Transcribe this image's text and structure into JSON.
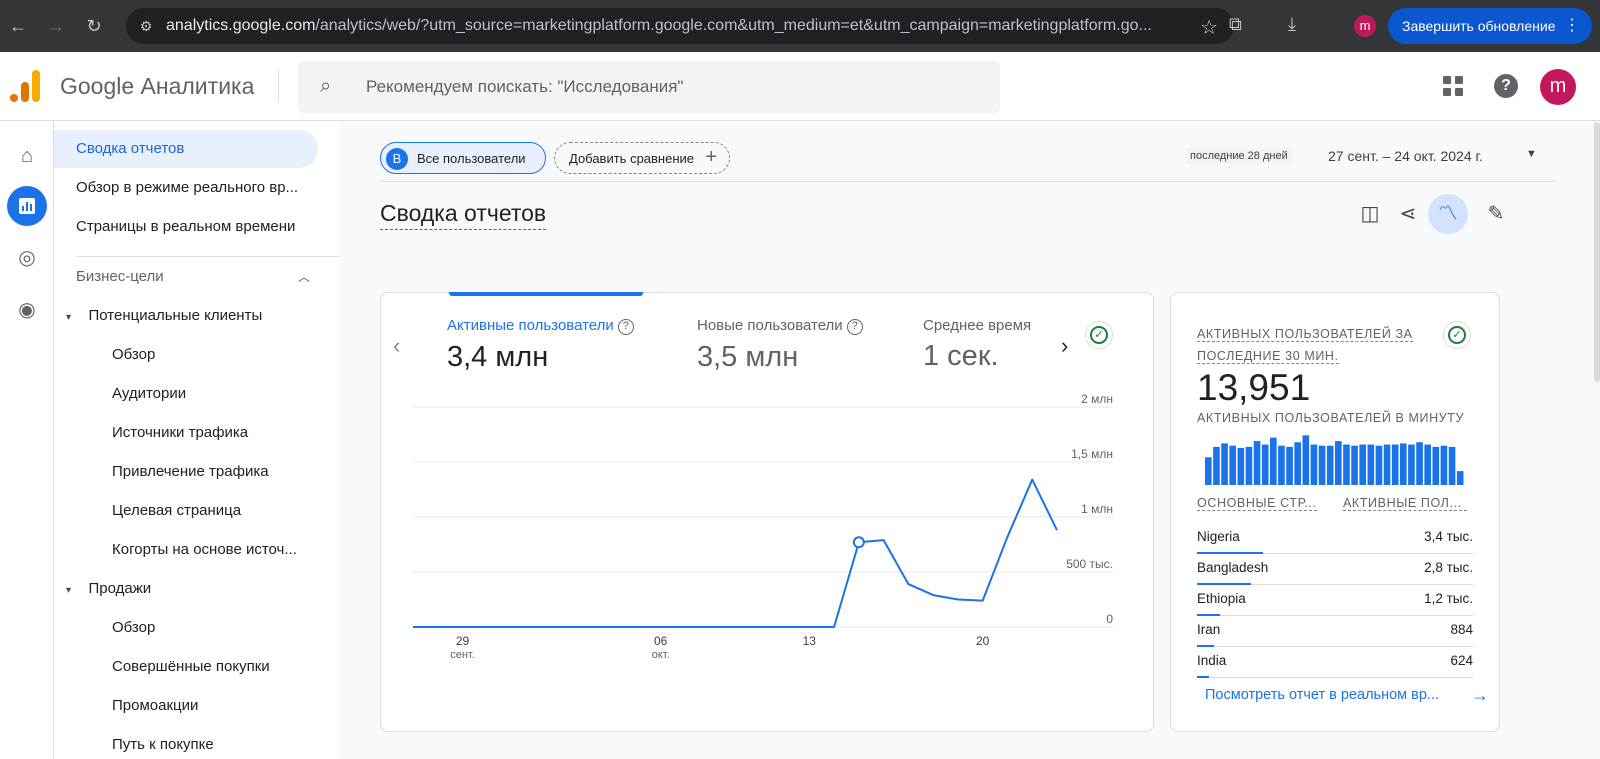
{
  "browser": {
    "url_host": "analytics.google.com",
    "url_path": "/analytics/web/?utm_source=marketingplatform.google.com&utm_medium=et&utm_campaign=marketingplatform.go...",
    "profile_initial": "m",
    "update_label": "Завершить обновление"
  },
  "header": {
    "brand": "Google Аналитика",
    "search_placeholder": "Рекомендуем поискать: \"Исследования\"",
    "avatar_initial": "m"
  },
  "sidebar": {
    "items": [
      {
        "label": "Сводка отчетов"
      },
      {
        "label": "Обзор в режиме реального вр..."
      },
      {
        "label": "Страницы в реальном времени"
      }
    ],
    "section": "Бизнес-цели",
    "groups": [
      {
        "label": "Потенциальные клиенты",
        "items": [
          "Обзор",
          "Аудитории",
          "Источники трафика",
          "Привлечение трафика",
          "Целевая страница",
          "Когорты на основе источ..."
        ]
      },
      {
        "label": "Продажи",
        "items": [
          "Обзор",
          "Совершённые покупки",
          "Промоакции",
          "Путь к покупке"
        ]
      }
    ]
  },
  "main": {
    "chip_all_badge": "В",
    "chip_all": "Все пользователи",
    "chip_add": "Добавить сравнение",
    "date_tag": "последние 28 дней",
    "date_range": "27 сент. – 24 окт. 2024 г.",
    "title": "Сводка отчетов",
    "kpis": [
      {
        "label": "Активные пользователи",
        "value": "3,4 млн"
      },
      {
        "label": "Новые пользователи",
        "value": "3,5 млн"
      },
      {
        "label": "Среднее время",
        "value": "1 сек."
      }
    ]
  },
  "chart_data": {
    "type": "line",
    "y_tick_labels": [
      "2 млн",
      "1,5 млн",
      "1 млн",
      "500 тыс.",
      "0"
    ],
    "y_ticks": [
      2000000,
      1500000,
      1000000,
      500000,
      0
    ],
    "ylim": [
      0,
      2000000
    ],
    "x_tick_labels": [
      {
        "day": "29",
        "month": "сент."
      },
      {
        "day": "06",
        "month": "окт."
      },
      {
        "day": "13",
        "month": ""
      },
      {
        "day": "20",
        "month": ""
      }
    ],
    "x_tick_indices": [
      2,
      10,
      16,
      23
    ],
    "series": [
      {
        "values": [
          0,
          0,
          0,
          0,
          0,
          0,
          0,
          0,
          0,
          0,
          0,
          0,
          0,
          0,
          0,
          0,
          0,
          0,
          770000,
          790000,
          390000,
          290000,
          250000,
          240000,
          820000,
          1340000,
          880000
        ]
      }
    ],
    "highlight_index": 18
  },
  "realtime": {
    "title": "АКТИВНЫХ ПОЛЬЗОВАТЕЛЕЙ ЗА ПОСЛЕДНИЕ 30 МИН.",
    "value": "13,951",
    "per_minute_label": "АКТИВНЫХ ПОЛЬЗОВАТЕЛЕЙ В МИНУТУ",
    "per_minute": [
      24,
      33,
      36,
      34,
      32,
      33,
      38,
      35,
      41,
      34,
      33,
      37,
      43,
      35,
      34,
      34,
      38,
      35,
      34,
      35,
      35,
      34,
      35,
      35,
      36,
      35,
      37,
      35,
      33,
      34,
      33,
      12
    ],
    "col_country": "ОСНОВНЫЕ СТР...",
    "col_users": "АКТИВНЫЕ ПОЛ...",
    "rows": [
      {
        "country": "Nigeria",
        "value": "3,4 тыс.",
        "share": 1.0
      },
      {
        "country": "Bangladesh",
        "value": "2,8 тыс.",
        "share": 0.82
      },
      {
        "country": "Ethiopia",
        "value": "1,2 тыс.",
        "share": 0.35
      },
      {
        "country": "Iran",
        "value": "884",
        "share": 0.26
      },
      {
        "country": "India",
        "value": "624",
        "share": 0.18
      }
    ],
    "view_link": "Посмотреть отчет в реальном вр..."
  },
  "colors": {
    "accent": "#1a73e8",
    "logo_orange": "#f9ab00",
    "logo_dark": "#e37400"
  }
}
